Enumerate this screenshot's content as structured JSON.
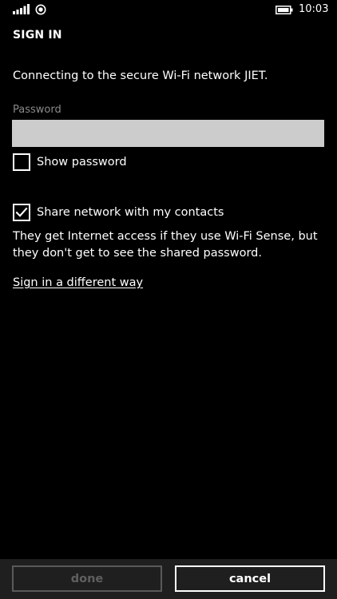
{
  "status_bar": {
    "time": "10:03",
    "icons": [
      "signal-bars-icon",
      "radio-icon",
      "battery-icon"
    ]
  },
  "page": {
    "title": "SIGN IN",
    "connect_message": "Connecting to the secure Wi-Fi network JIET.",
    "password_label": "Password",
    "password_value": "",
    "password_placeholder": ""
  },
  "options": {
    "show_password": {
      "label": "Show password",
      "checked": false
    },
    "share_network": {
      "label": "Share network with my contacts",
      "checked": true
    }
  },
  "share_description": "They get Internet access if they use Wi-Fi Sense, but they don't get to see the shared password.",
  "alt_signin_link": "Sign in a different way",
  "app_bar": {
    "done_label": "done",
    "done_enabled": false,
    "cancel_label": "cancel"
  },
  "colors": {
    "background": "#000000",
    "foreground": "#ffffff",
    "input_background": "#cccccc",
    "label_gray": "#8a8a8a",
    "app_bar": "#1f1f1f",
    "disabled": "#5f5f5f"
  }
}
